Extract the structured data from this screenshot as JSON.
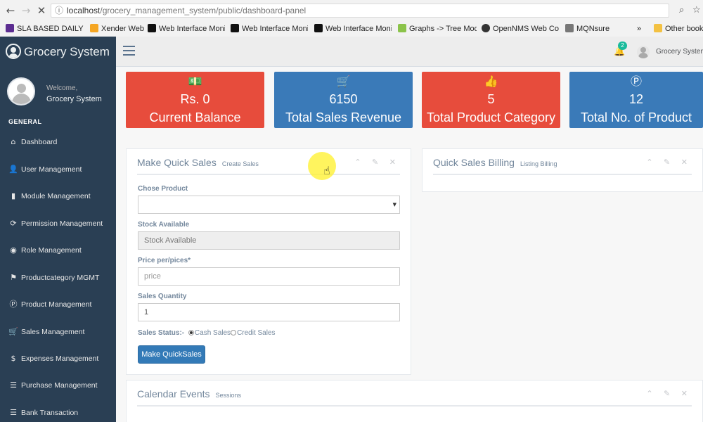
{
  "browser": {
    "url_host": "localhost",
    "url_path": "/grocery_management_system/public/dashboard-panel",
    "icons": {
      "back": "back-arrow-icon",
      "forward": "forward-arrow-icon",
      "stop": "stop-icon",
      "info": "info-icon",
      "search": "search-icon",
      "star": "star-icon"
    },
    "bookmarks": [
      {
        "label": "SLA BASED DAILY FO",
        "color": "#5c2d91"
      },
      {
        "label": "Xender Web",
        "color": "#f5a623"
      },
      {
        "label": "Web Interface Monit",
        "color": "#111111"
      },
      {
        "label": "Web Interface Monit",
        "color": "#111111"
      },
      {
        "label": "Web Interface Monit",
        "color": "#111111"
      },
      {
        "label": "Graphs -> Tree Mode",
        "color": "#8bc34a"
      },
      {
        "label": "OpenNMS Web Cons",
        "color": "#333333"
      },
      {
        "label": "MQNsure",
        "color": "#777777"
      }
    ],
    "more_bookmarks": "»",
    "other_bookmarks": "Other bookm"
  },
  "sidebar": {
    "brand": "Grocery System",
    "welcome": "Welcome,",
    "user": "Grocery System",
    "section": "GENERAL",
    "items": [
      {
        "label": "Dashboard",
        "icon": "home-icon",
        "glyph": "⌂"
      },
      {
        "label": "User Management",
        "icon": "user-icon",
        "glyph": "👤"
      },
      {
        "label": "Module Management",
        "icon": "signal-icon",
        "glyph": "▮"
      },
      {
        "label": "Permission Management",
        "icon": "refresh-icon",
        "glyph": "⟳"
      },
      {
        "label": "Role Management",
        "icon": "eye-icon",
        "glyph": "◉"
      },
      {
        "label": "Productcategory MGMT",
        "icon": "flag-icon",
        "glyph": "⚑"
      },
      {
        "label": "Product Management",
        "icon": "product-p-icon",
        "glyph": "Ⓟ"
      },
      {
        "label": "Sales Management",
        "icon": "cart-icon",
        "glyph": "🛒"
      },
      {
        "label": "Expenses Management",
        "icon": "dollar-icon",
        "glyph": "$"
      },
      {
        "label": "Purchase Management",
        "icon": "list-icon",
        "glyph": "☰"
      },
      {
        "label": "Bank Transaction",
        "icon": "bank-icon",
        "glyph": "☰"
      }
    ]
  },
  "topnav": {
    "bell_count": "2",
    "user": "Grocery System"
  },
  "tiles": [
    {
      "value": "Rs. 0",
      "label": "Current Balance",
      "icon": "money-icon",
      "glyph": "💵",
      "color": "#e74c3c"
    },
    {
      "value": "6150",
      "label": "Total Sales Revenue",
      "icon": "cart-icon",
      "glyph": "🛒",
      "color": "#3a7ab8"
    },
    {
      "value": "5",
      "label": "Total Product Category",
      "icon": "thumbs-up-icon",
      "glyph": "👍",
      "color": "#e74c3c"
    },
    {
      "value": "12",
      "label": "Total No. of Product",
      "icon": "product-p-icon",
      "glyph": "Ⓟ",
      "color": "#3a7ab8"
    }
  ],
  "quick_sales": {
    "title": "Make Quick Sales",
    "subtitle": "Create Sales",
    "controls": "⌃ ✎ ✕",
    "product_label": "Chose Product",
    "product_value": "",
    "stock_label": "Stock Available",
    "stock_placeholder": "Stock Available",
    "price_label": "Price per/pices*",
    "price_placeholder": "price",
    "qty_label": "Sales Quantity",
    "qty_value": "1",
    "status_label": "Sales Status:-",
    "status_options": [
      "Cash Sales",
      "Credit Sales"
    ],
    "status_selected": "Cash Sales",
    "submit": "Make QuickSales"
  },
  "billing": {
    "title": "Quick Sales Billing",
    "subtitle": "Listing Billing",
    "controls": "⌃ ✎ ✕"
  },
  "calendar": {
    "title": "Calendar Events",
    "subtitle": "Sessions",
    "controls": "⌃ ✎ ✕"
  }
}
